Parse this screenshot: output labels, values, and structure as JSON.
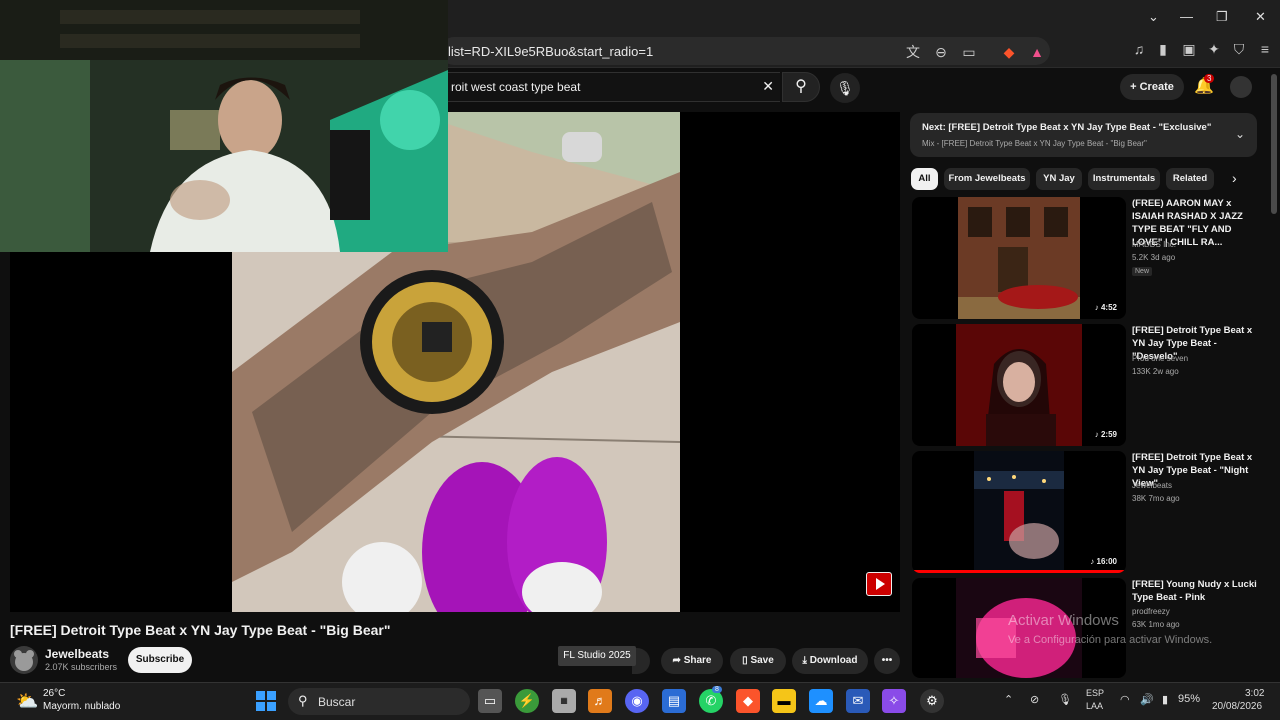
{
  "browser": {
    "url": "list=RD-XIL9e5RBuo&start_radio=1",
    "window_controls": [
      "chevron",
      "minimize",
      "restore",
      "close"
    ]
  },
  "youtube": {
    "search_query": "roit west coast type beat",
    "create_label": "Create",
    "notification_count": "3"
  },
  "video": {
    "title": "[FREE] Detroit Type Beat x YN Jay Type Beat - \"Big Bear\"",
    "channel": "Jewelbeats",
    "subscribers": "2.07K subscribers",
    "subscribe_label": "Subscribe",
    "tooltip": "FL Studio 2025",
    "actions": {
      "share": "Share",
      "save": "Save",
      "download": "Download"
    }
  },
  "sidebar": {
    "next_title": "Next: [FREE] Detroit Type Beat x YN Jay Type Beat - \"Exclusive\"",
    "next_sub": "Mix - [FREE] Detroit Type Beat x YN Jay Type Beat - \"Big Bear\"",
    "chips": [
      "All",
      "From Jewelbeats",
      "YN Jay",
      "Instrumentals",
      "Related"
    ],
    "recommendations": [
      {
        "title": "(FREE) AARON MAY x ISAIAH RASHAD X JAZZ TYPE BEAT \"FLY AND LOVE\" | CHILL RA...",
        "channel": "MADDS Inc.",
        "meta": "5.2K  3d ago",
        "badge": "New",
        "duration": "4:52"
      },
      {
        "title": "[FREE] Detroit Type Beat x YN Jay Type Beat - \"Desvelo\"",
        "channel": "Prod one seven",
        "meta": "133K  2w ago",
        "duration": "2:59"
      },
      {
        "title": "[FREE] Detroit Type Beat x YN Jay Type Beat - \"Night View\"",
        "channel": "Jewelbeats",
        "meta": "38K  7mo ago",
        "duration": "16:00"
      },
      {
        "title": "[FREE] Young Nudy x Lucki Type Beat - Pink",
        "channel": "prodfreezy",
        "meta": "63K  1mo ago",
        "duration": ""
      }
    ]
  },
  "watermark": {
    "line1": "Activar Windows",
    "line2": "Ve a Configuración para activar Windows."
  },
  "taskbar": {
    "temp": "26°C",
    "weather": "Mayorm. nublado",
    "search_placeholder": "Buscar",
    "lang1": "ESP",
    "lang2": "LAA",
    "battery": "95%",
    "time": "3:02",
    "date": "20/08/2026",
    "discord_badge": "8"
  }
}
